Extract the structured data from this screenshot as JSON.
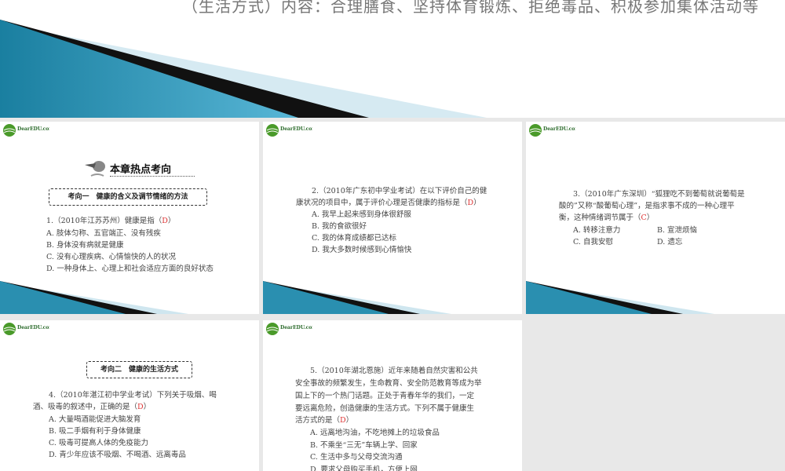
{
  "top": {
    "text": "（生活方式）内容：合理膳食、坚持体育锻炼、拒绝毒品、积极参加集体活动等"
  },
  "logo": "DearEDU.com",
  "s1": {
    "title": "本章热点考向",
    "box": "考向一　健康的含义及调节情绪的方法",
    "q": "1.（2010年江苏苏州）健康是指（",
    "ans": "D",
    "close": "）",
    "opts": [
      "A. 肢体匀称、五官端正、没有残疾",
      "B. 身体没有病就是健康",
      "C. 没有心理疾病、心情愉快的人的状况",
      "D. 一种身体上、心理上和社会适应方面的良好状态"
    ]
  },
  "s2": {
    "q1": "2.（2010年广东初中学业考试）在以下评价自己的健",
    "q2": "康状况的项目中，属于评价心理是否健康的指标是（",
    "ans": "D",
    "close": "）",
    "opts": [
      "A. 我早上起来感到身体很舒服",
      "B. 我的食欲很好",
      "C. 我的体育成绩都已达标",
      "D. 我大多数时候感到心情愉快"
    ]
  },
  "s3": {
    "q1": "3.（2010年广东深圳）“狐狸吃不到葡萄就说葡萄是",
    "q2": "酸的”又称“酸葡萄心理”，是指求事不成的一种心理平",
    "q3": "衡，这种情绪调节属于（",
    "ans": "C",
    "close": "）",
    "opts": [
      "A. 转移注意力",
      "B. 宣泄烦恼",
      "C. 自我安慰",
      "D. 遗忘"
    ]
  },
  "s4": {
    "box": "考向二　健康的生活方式",
    "q1": "4.（2010年湛江初中学业考试）下列关于吸烟、喝",
    "q2": "酒、吸毒的叙述中，正确的是（",
    "ans": "D",
    "close": "）",
    "opts": [
      "A. 大量喝酒能促进大脑发育",
      "B. 吸二手烟有利于身体健康",
      "C. 吸毒可提高人体的免疫能力",
      "D. 青少年应该不吸烟、不喝酒、远离毒品"
    ]
  },
  "s5": {
    "lines": [
      "5.（2010年湖北恩施）近年来随着自然灾害和公共",
      "安全事故的频繁发生，生命教育、安全防范教育等成为举",
      "国上下的一个热门话题。正处于青春年华的我们，一定",
      "要远离危险，创造健康的生活方式。下列不属于健康生"
    ],
    "q5": "活方式的是（",
    "ans": "D",
    "close": "）",
    "opts": [
      "A. 远离地沟油，不吃地摊上的垃圾食品",
      "B. 不乘坐“三无”车辆上学、回家",
      "C. 生活中多与父母交流沟通",
      "D. 要求父母购买手机，方便上网"
    ]
  }
}
